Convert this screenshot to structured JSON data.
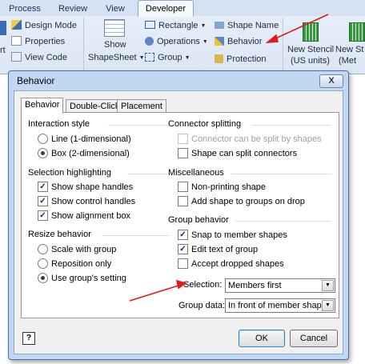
{
  "ribbon": {
    "tabs": [
      "Process",
      "Review",
      "View",
      "Developer"
    ],
    "active_tab": "Developer",
    "left_fragment": "rt",
    "group1": [
      "Design Mode",
      "Properties",
      "View Code"
    ],
    "show_shapesheet": [
      "Show",
      "ShapeSheet"
    ],
    "group2": [
      "Rectangle",
      "Operations",
      "Group"
    ],
    "group3": [
      "Shape Name",
      "Behavior",
      "Protection"
    ],
    "new_stencil_us": [
      "New Stencil",
      "(US units)"
    ],
    "new_stencil_metric": [
      "New St",
      "(Met"
    ]
  },
  "dialog": {
    "title": "Behavior",
    "close": "X",
    "tabs": [
      "Behavior",
      "Double-Click",
      "Placement"
    ],
    "interaction_style": {
      "heading": "Interaction style",
      "options": [
        {
          "label": "Line (1-dimensional)",
          "selected": false
        },
        {
          "label": "Box (2-dimensional)",
          "selected": true
        }
      ]
    },
    "selection_highlighting": {
      "heading": "Selection highlighting",
      "options": [
        {
          "label": "Show shape handles",
          "checked": true
        },
        {
          "label": "Show control handles",
          "checked": true
        },
        {
          "label": "Show alignment box",
          "checked": true
        }
      ]
    },
    "resize_behavior": {
      "heading": "Resize behavior",
      "options": [
        {
          "label": "Scale with group",
          "selected": false
        },
        {
          "label": "Reposition only",
          "selected": false
        },
        {
          "label": "Use group's setting",
          "selected": true
        }
      ]
    },
    "connector_splitting": {
      "heading": "Connector splitting",
      "options": [
        {
          "label": "Connector can be split by shapes",
          "checked": false,
          "disabled": true
        },
        {
          "label": "Shape can split connectors",
          "checked": false,
          "disabled": false
        }
      ]
    },
    "miscellaneous": {
      "heading": "Miscellaneous",
      "options": [
        {
          "label": "Non-printing shape",
          "checked": false
        },
        {
          "label": "Add shape to groups on drop",
          "checked": false
        }
      ]
    },
    "group_behavior": {
      "heading": "Group behavior",
      "options": [
        {
          "label": "Snap to member shapes",
          "checked": true
        },
        {
          "label": "Edit text of group",
          "checked": true
        },
        {
          "label": "Accept dropped shapes",
          "checked": false
        }
      ]
    },
    "selection": {
      "label": "Selection:",
      "value": "Members first"
    },
    "group_data": {
      "label": "Group data:",
      "value": "In front of member shapes"
    },
    "help": "?",
    "ok": "OK",
    "cancel": "Cancel"
  },
  "colors": {
    "annotation_arrow": "#e01b1b",
    "stencil_green": "#2f9e3a"
  }
}
